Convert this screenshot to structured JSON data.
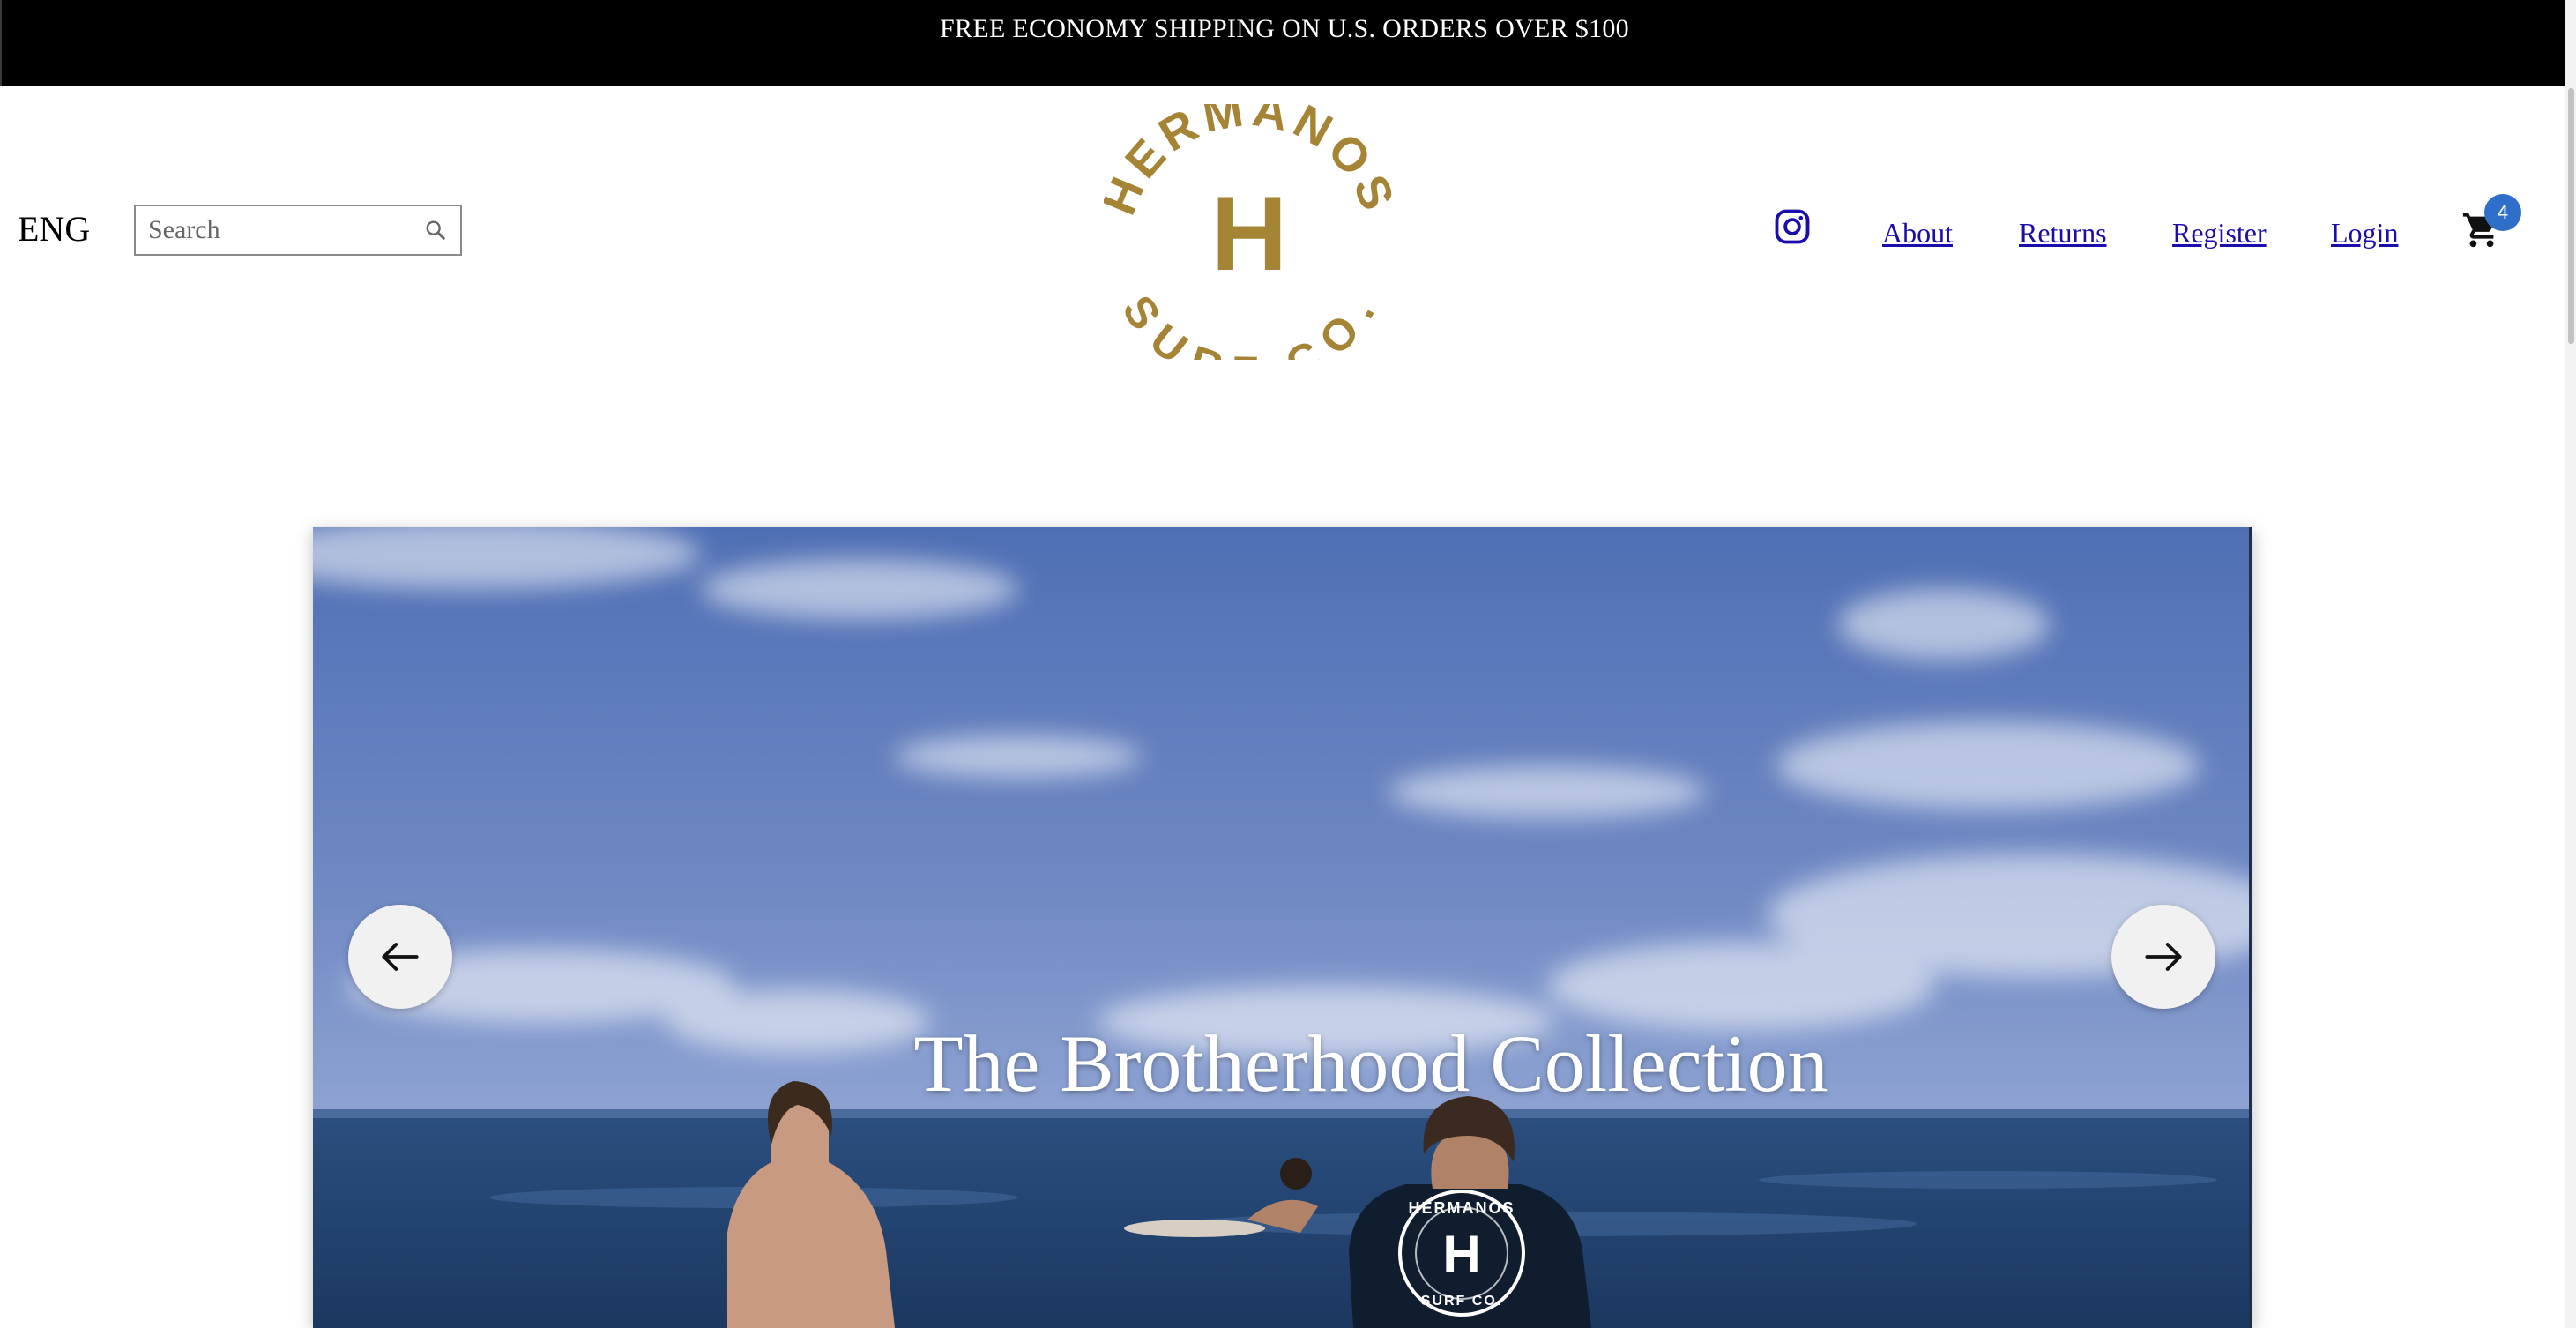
{
  "promo": {
    "text": "FREE ECONOMY SHIPPING ON U.S. ORDERS OVER $100"
  },
  "header": {
    "language": "ENG",
    "search": {
      "placeholder": "Search",
      "value": ""
    },
    "logo": {
      "top_text": "HERMANOS",
      "monogram": "H",
      "bottom_text": "SURF CO.",
      "color": "#A68436"
    },
    "nav": {
      "about": "About",
      "returns": "Returns",
      "register": "Register",
      "login": "Login"
    },
    "cart_count": "4",
    "icons": {
      "social": "instagram-icon",
      "cart": "cart-icon",
      "search": "search-icon"
    }
  },
  "hero": {
    "title": "The Brotherhood Collection",
    "shirt_print": {
      "top_text": "HERMANOS",
      "monogram": "H",
      "bottom_text": "SURF CO."
    },
    "prev_icon": "arrow-left-icon",
    "next_icon": "arrow-right-icon"
  },
  "colors": {
    "promo_bg": "#000000",
    "link": "#1a0dab",
    "badge": "#2f6fc9",
    "logo": "#A68436"
  }
}
